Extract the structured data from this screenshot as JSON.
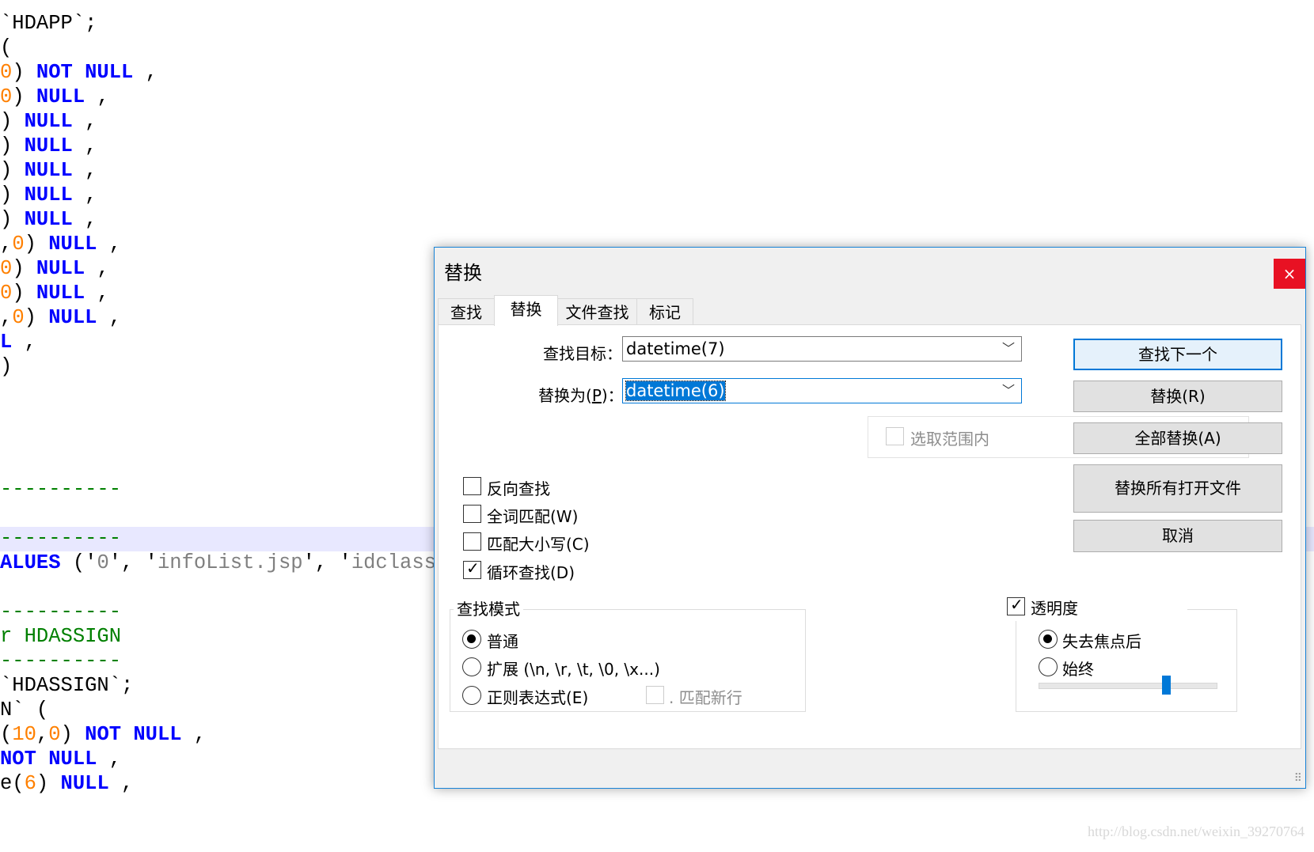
{
  "editor": {
    "lines": [
      [
        {
          "t": "`HDAPP`;",
          "c": "txt"
        }
      ],
      [
        {
          "t": "(",
          "c": "txt"
        }
      ],
      [
        {
          "t": "0",
          "c": "num"
        },
        {
          "t": ") ",
          "c": "txt"
        },
        {
          "t": "NOT NULL",
          "c": "kw"
        },
        {
          "t": " ,",
          "c": "txt"
        }
      ],
      [
        {
          "t": "0",
          "c": "num"
        },
        {
          "t": ") ",
          "c": "txt"
        },
        {
          "t": "NULL",
          "c": "kw"
        },
        {
          "t": " ,",
          "c": "txt"
        }
      ],
      [
        {
          "t": ") ",
          "c": "txt"
        },
        {
          "t": "NULL",
          "c": "kw"
        },
        {
          "t": " ,",
          "c": "txt"
        }
      ],
      [
        {
          "t": ") ",
          "c": "txt"
        },
        {
          "t": "NULL",
          "c": "kw"
        },
        {
          "t": " ,",
          "c": "txt"
        }
      ],
      [
        {
          "t": ") ",
          "c": "txt"
        },
        {
          "t": "NULL",
          "c": "kw"
        },
        {
          "t": " ,",
          "c": "txt"
        }
      ],
      [
        {
          "t": ") ",
          "c": "txt"
        },
        {
          "t": "NULL",
          "c": "kw"
        },
        {
          "t": " ,",
          "c": "txt"
        }
      ],
      [
        {
          "t": ") ",
          "c": "txt"
        },
        {
          "t": "NULL",
          "c": "kw"
        },
        {
          "t": " ,",
          "c": "txt"
        }
      ],
      [
        {
          "t": ",",
          "c": "txt"
        },
        {
          "t": "0",
          "c": "num"
        },
        {
          "t": ") ",
          "c": "txt"
        },
        {
          "t": "NULL",
          "c": "kw"
        },
        {
          "t": " ,",
          "c": "txt"
        }
      ],
      [
        {
          "t": "0",
          "c": "num"
        },
        {
          "t": ") ",
          "c": "txt"
        },
        {
          "t": "NULL",
          "c": "kw"
        },
        {
          "t": " ,",
          "c": "txt"
        }
      ],
      [
        {
          "t": "0",
          "c": "num"
        },
        {
          "t": ") ",
          "c": "txt"
        },
        {
          "t": "NULL",
          "c": "kw"
        },
        {
          "t": " ,",
          "c": "txt"
        }
      ],
      [
        {
          "t": ",",
          "c": "txt"
        },
        {
          "t": "0",
          "c": "num"
        },
        {
          "t": ") ",
          "c": "txt"
        },
        {
          "t": "NULL",
          "c": "kw"
        },
        {
          "t": " ,",
          "c": "txt"
        }
      ],
      [
        {
          "t": "L",
          "c": "kw"
        },
        {
          "t": " ,",
          "c": "txt"
        }
      ],
      [
        {
          "t": ")",
          "c": "txt"
        }
      ],
      [],
      [],
      [],
      [],
      [
        {
          "t": "----------",
          "c": "grn"
        }
      ],
      [],
      [
        {
          "t": "----------",
          "c": "grn"
        }
      ],
      [
        {
          "t": "ALUES",
          "c": "kw"
        },
        {
          "t": " ('",
          "c": "txt"
        },
        {
          "t": "0",
          "c": "str"
        },
        {
          "t": "', '",
          "c": "txt"
        },
        {
          "t": "infoList.jsp",
          "c": "str"
        },
        {
          "t": "', '",
          "c": "txt"
        },
        {
          "t": "idclass",
          "c": "str"
        }
      ],
      [],
      [
        {
          "t": "----------",
          "c": "grn"
        }
      ],
      [
        {
          "t": "r HDASSIGN",
          "c": "grn"
        }
      ],
      [
        {
          "t": "----------",
          "c": "grn"
        }
      ],
      [
        {
          "t": "`HDASSIGN`;",
          "c": "txt"
        }
      ],
      [
        {
          "t": "N` (",
          "c": "txt"
        }
      ],
      [
        {
          "t": "(",
          "c": "txt"
        },
        {
          "t": "10",
          "c": "num"
        },
        {
          "t": ",",
          "c": "txt"
        },
        {
          "t": "0",
          "c": "num"
        },
        {
          "t": ") ",
          "c": "txt"
        },
        {
          "t": "NOT NULL",
          "c": "kw"
        },
        {
          "t": " ,",
          "c": "txt"
        }
      ],
      [
        {
          "t": "NOT NULL",
          "c": "kw"
        },
        {
          "t": " ,",
          "c": "txt"
        }
      ],
      [
        {
          "t": "e(",
          "c": "txt"
        },
        {
          "t": "6",
          "c": "num"
        },
        {
          "t": ") ",
          "c": "txt"
        },
        {
          "t": "NULL",
          "c": "kw"
        },
        {
          "t": " ,",
          "c": "txt"
        }
      ]
    ],
    "watermark": "http://blog.csdn.net/weixin_39270764"
  },
  "dialog": {
    "title": "替换",
    "close_glyph": "×",
    "tabs": [
      "查找",
      "替换",
      "文件查找",
      "标记"
    ],
    "active_tab": 1,
    "find_label": "查找目标：",
    "find_value": "datetime(7)",
    "replace_label_pre": "替换为(",
    "replace_label_key": "P",
    "replace_label_post": ")：",
    "replace_value": "datetime(6)",
    "in_selection": "选取范围内",
    "buttons": {
      "find_next": "查找下一个",
      "replace": "替换(R)",
      "replace_all": "全部替换(A)",
      "replace_all_open": "替换所有打开文件",
      "cancel": "取消"
    },
    "options": {
      "backward": {
        "label": "反向查找",
        "checked": false
      },
      "whole_word": {
        "label": "全词匹配(W)",
        "checked": false
      },
      "match_case": {
        "label": "匹配大小写(C)",
        "checked": false
      },
      "wrap": {
        "label": "循环查找(D)",
        "checked": true
      }
    },
    "search_mode": {
      "title": "查找模式",
      "normal": "普通",
      "extended": "扩展 (\\n, \\r, \\t, \\0, \\x...)",
      "regex": "正则表达式(E)",
      "dot_newline": ". 匹配新行",
      "selected": "normal"
    },
    "transparency": {
      "title": "透明度",
      "checked": true,
      "on_lose_focus": "失去焦点后",
      "always": "始终",
      "selected": "on_lose_focus",
      "level": 0.72
    },
    "check_mark": "✓",
    "chevron": "﹀"
  }
}
